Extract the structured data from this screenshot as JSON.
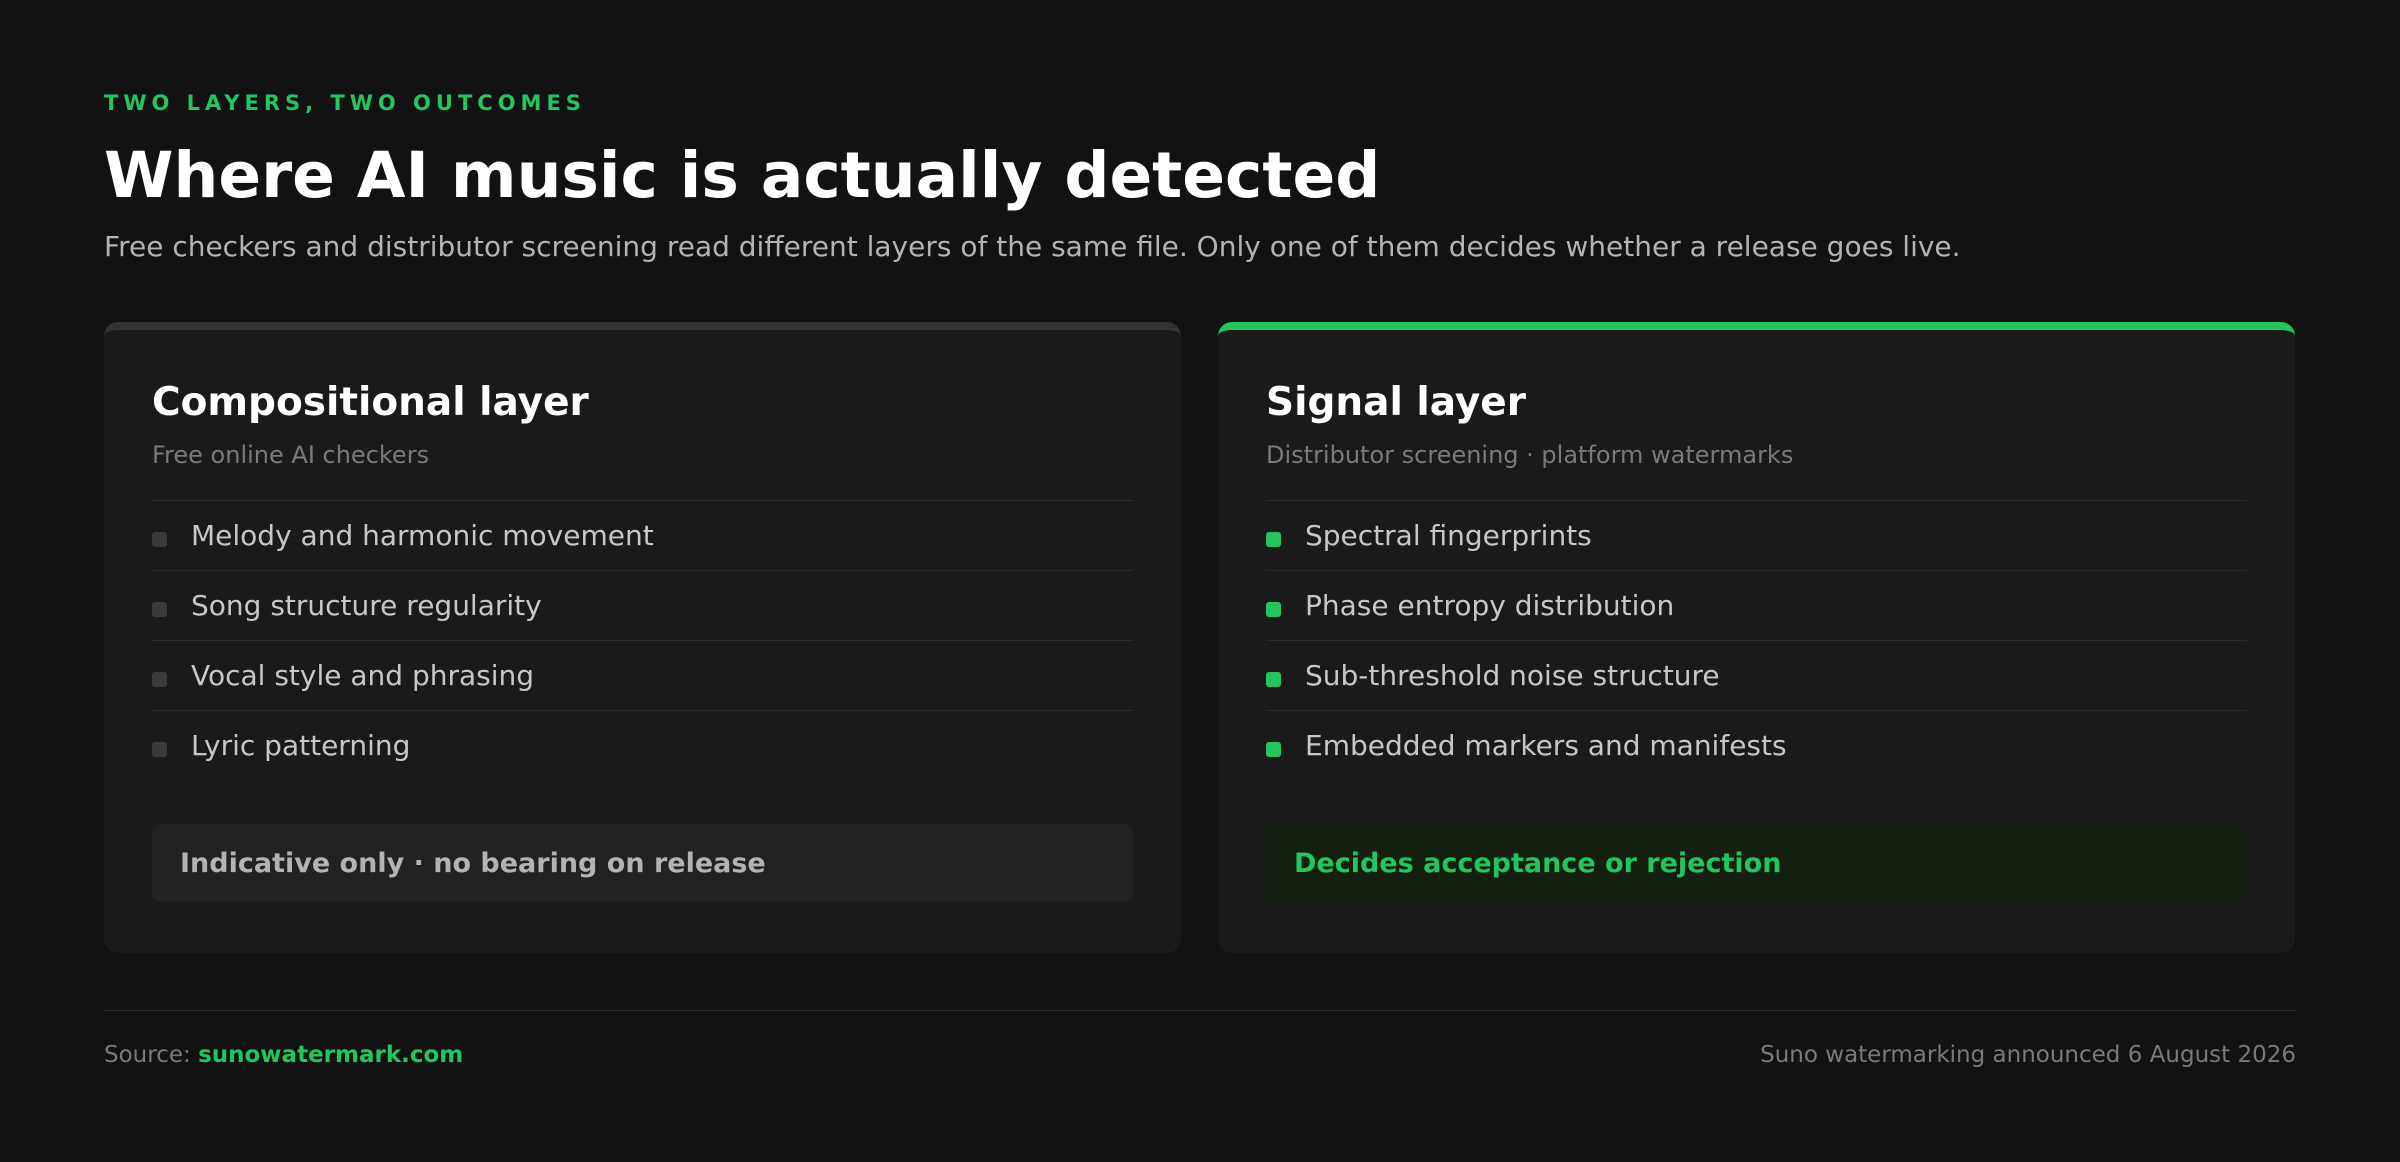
{
  "header": {
    "eyebrow": "TWO LAYERS, TWO OUTCOMES",
    "title": "Where AI music is actually detected",
    "subtitle": "Free checkers and distributor screening read different layers of the same file. Only one of them decides whether a release goes live."
  },
  "cards": [
    {
      "title": "Compositional layer",
      "subtitle": "Free online AI checkers",
      "items": [
        "Melody and harmonic movement",
        "Song structure regularity",
        "Vocal style and phrasing",
        "Lyric patterning"
      ],
      "verdict": "Indicative only · no bearing on release"
    },
    {
      "title": "Signal layer",
      "subtitle": "Distributor screening · platform watermarks",
      "items": [
        "Spectral fingerprints",
        "Phase entropy distribution",
        "Sub-threshold noise structure",
        "Embedded markers and manifests"
      ],
      "verdict": "Decides acceptance or rejection"
    }
  ],
  "footer": {
    "source_label": "Source:",
    "source_link": "sunowatermark.com",
    "note": "Suno watermarking announced 6 August 2026"
  },
  "colors": {
    "accent": "#22c55e",
    "background": "#121212",
    "card": "#1a1a1a"
  }
}
